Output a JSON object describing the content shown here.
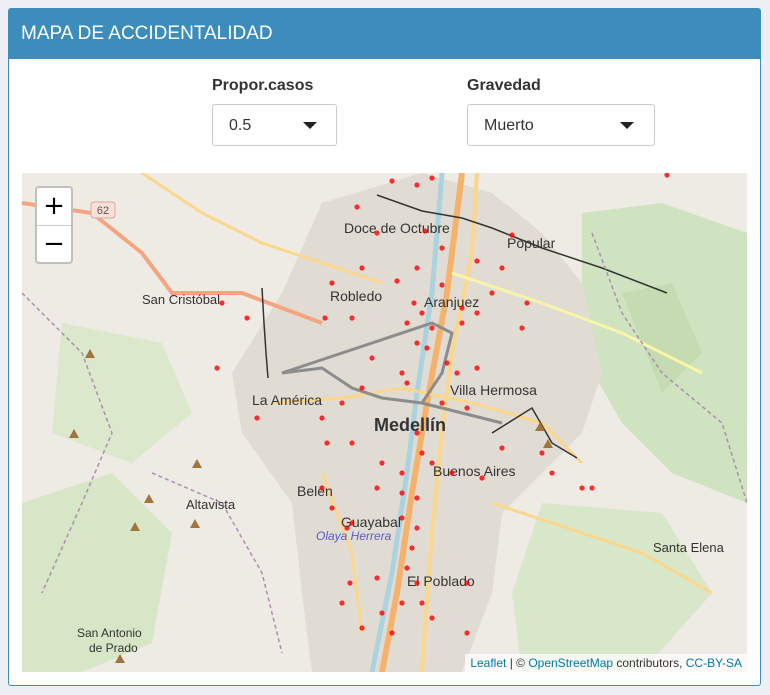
{
  "header": {
    "title": "MAPA DE ACCIDENTALIDAD"
  },
  "controls": {
    "proportion": {
      "label": "Propor.casos",
      "value": "0.5"
    },
    "severity": {
      "label": "Gravedad",
      "value": "Muerto"
    }
  },
  "map": {
    "zoom_in": "+",
    "zoom_out": "−",
    "road_shield": "62",
    "places": {
      "doce_de_octubre": "Doce de Octubre",
      "popular": "Popular",
      "san_cristobal": "San Cristóbal",
      "robledo": "Robledo",
      "aranjuez": "Aranjuez",
      "villa_hermosa": "Villa Hermosa",
      "la_america": "La América",
      "medellin": "Medellín",
      "buenos_aires": "Buenos Aires",
      "belen": "Belén",
      "altavista": "Altavista",
      "guayabal": "Guayabal",
      "olaya_herrera": "Olaya Herrera",
      "santa_elena": "Santa Elena",
      "el_poblado": "El Poblado",
      "san_antonio_de_prado_1": "San Antonio",
      "san_antonio_de_prado_2": "de Prado"
    },
    "attribution": {
      "leaflet": "Leaflet",
      "sep": " | © ",
      "osm": "OpenStreetMap",
      "contributors": " contributors, ",
      "license": "CC-BY-SA"
    },
    "marker_color": "#ff0000"
  }
}
